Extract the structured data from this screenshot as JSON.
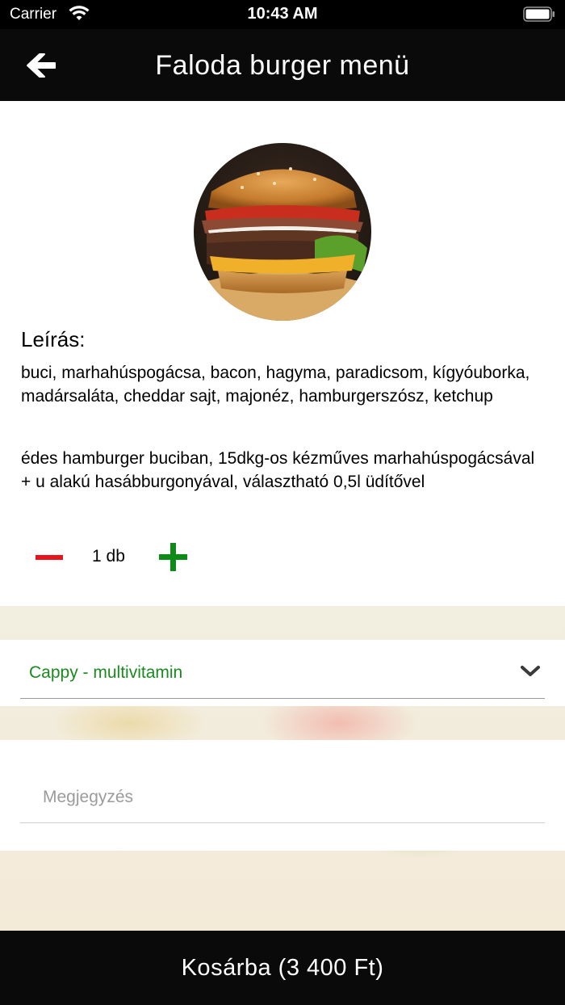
{
  "status_bar": {
    "carrier": "Carrier",
    "time": "10:43 AM"
  },
  "nav": {
    "title": "Faloda burger menü",
    "back_icon": "arrow-left-icon"
  },
  "product": {
    "image_icon": "burger-photo",
    "description_heading": "Leírás:",
    "ingredients": "buci, marhahúspogácsa, bacon, hagyma, paradicsom, kígyóuborka, madársaláta, cheddar sajt, majonéz, hamburgerszósz, ketchup",
    "details_line1": "édes hamburger buciban, 15dkg-os kézműves marhahúspogácsával",
    "details_line2": "+ u alakú hasábburgonyával, választható 0,5l üdítővel"
  },
  "quantity": {
    "text": "1 db"
  },
  "drink": {
    "selected": "Cappy - multivitamin"
  },
  "note": {
    "placeholder": "Megjegyzés"
  },
  "cart": {
    "label": "Kosárba (3 400 Ft)"
  },
  "colors": {
    "nav_background": "#0a0a0a",
    "minus": "#e8131b",
    "plus": "#0e8a18",
    "drink_text": "#1a8a1f"
  }
}
